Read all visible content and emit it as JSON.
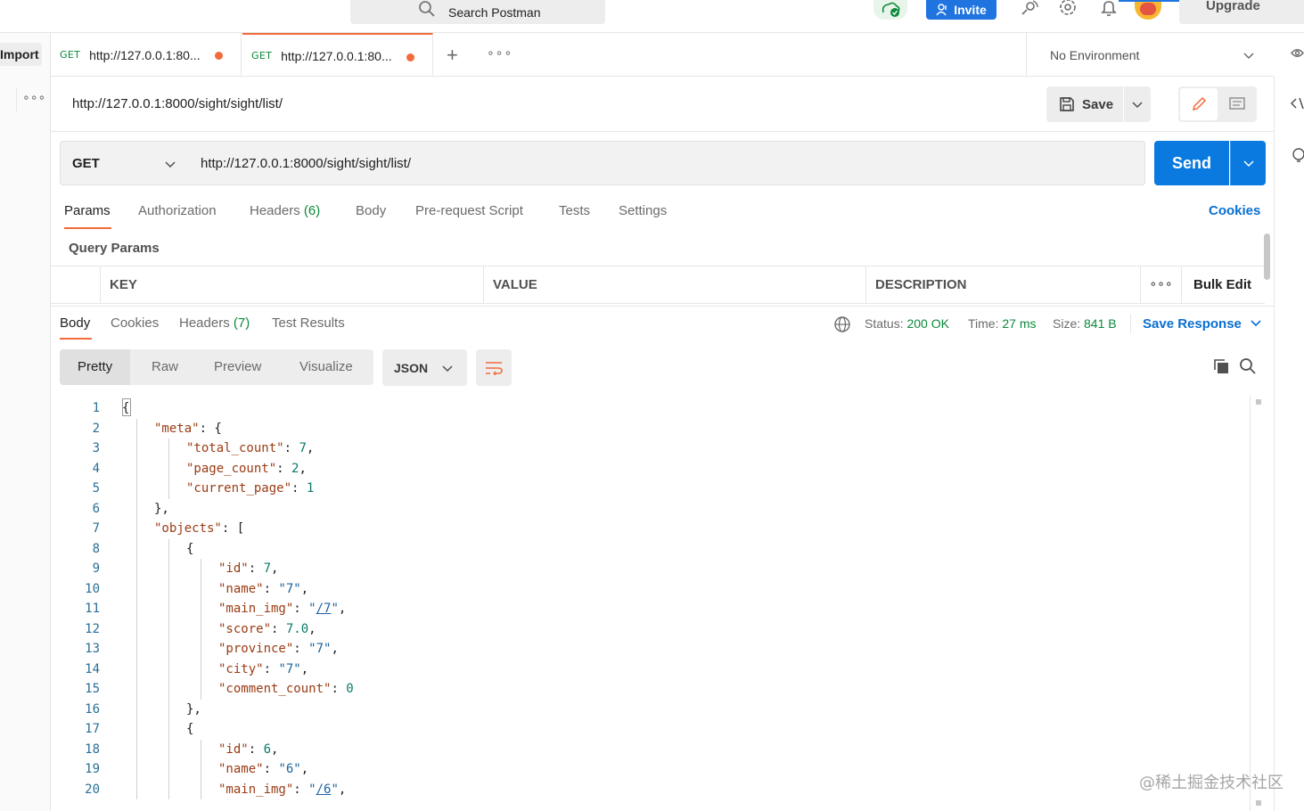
{
  "header": {
    "search_placeholder": "Search Postman",
    "invite_label": "Invite",
    "upgrade_label": "Upgrade"
  },
  "sidebar": {
    "import_label": "Import",
    "more_label": "∘∘∘"
  },
  "tabs": [
    {
      "method": "GET",
      "url": "http://127.0.0.1:80...",
      "unsaved": true,
      "active": false
    },
    {
      "method": "GET",
      "url": "http://127.0.0.1:80...",
      "unsaved": true,
      "active": true
    }
  ],
  "tabs_bar": {
    "add_label": "+",
    "more_label": "∘∘∘",
    "environment": "No Environment"
  },
  "request": {
    "title": "http://127.0.0.1:8000/sight/sight/list/",
    "save_label": "Save",
    "method": "GET",
    "url": "http://127.0.0.1:8000/sight/sight/list/",
    "send_label": "Send"
  },
  "request_tabs": {
    "items": [
      {
        "label": "Params",
        "count": ""
      },
      {
        "label": "Authorization",
        "count": ""
      },
      {
        "label": "Headers",
        "count": "(6)"
      },
      {
        "label": "Body",
        "count": ""
      },
      {
        "label": "Pre-request Script",
        "count": ""
      },
      {
        "label": "Tests",
        "count": ""
      },
      {
        "label": "Settings",
        "count": ""
      }
    ],
    "cookies_label": "Cookies"
  },
  "query_params": {
    "title": "Query Params",
    "columns": [
      "KEY",
      "VALUE",
      "DESCRIPTION"
    ],
    "more_label": "∘∘∘",
    "bulk_edit_label": "Bulk Edit"
  },
  "response": {
    "tabs": [
      {
        "label": "Body",
        "count": ""
      },
      {
        "label": "Cookies",
        "count": ""
      },
      {
        "label": "Headers",
        "count": "(7)"
      },
      {
        "label": "Test Results",
        "count": ""
      }
    ],
    "status_label": "Status:",
    "status_value": "200 OK",
    "time_label": "Time:",
    "time_value": "27 ms",
    "size_label": "Size:",
    "size_value": "841 B",
    "save_response_label": "Save Response",
    "views": [
      "Pretty",
      "Raw",
      "Preview",
      "Visualize"
    ],
    "format": "JSON"
  },
  "code_lines": [
    {
      "n": "1",
      "indent": 0,
      "parts": [
        [
          "p",
          "{"
        ]
      ]
    },
    {
      "n": "2",
      "indent": 1,
      "parts": [
        [
          "k",
          "\"meta\""
        ],
        [
          "p",
          ": {"
        ]
      ]
    },
    {
      "n": "3",
      "indent": 2,
      "parts": [
        [
          "k",
          "\"total_count\""
        ],
        [
          "p",
          ": "
        ],
        [
          "n",
          "7"
        ],
        [
          "p",
          ","
        ]
      ]
    },
    {
      "n": "4",
      "indent": 2,
      "parts": [
        [
          "k",
          "\"page_count\""
        ],
        [
          "p",
          ": "
        ],
        [
          "n",
          "2"
        ],
        [
          "p",
          ","
        ]
      ]
    },
    {
      "n": "5",
      "indent": 2,
      "parts": [
        [
          "k",
          "\"current_page\""
        ],
        [
          "p",
          ": "
        ],
        [
          "n",
          "1"
        ]
      ]
    },
    {
      "n": "6",
      "indent": 1,
      "parts": [
        [
          "p",
          "},"
        ]
      ]
    },
    {
      "n": "7",
      "indent": 1,
      "parts": [
        [
          "k",
          "\"objects\""
        ],
        [
          "p",
          ": ["
        ]
      ]
    },
    {
      "n": "8",
      "indent": 2,
      "parts": [
        [
          "p",
          "{"
        ]
      ]
    },
    {
      "n": "9",
      "indent": 3,
      "parts": [
        [
          "k",
          "\"id\""
        ],
        [
          "p",
          ": "
        ],
        [
          "n",
          "7"
        ],
        [
          "p",
          ","
        ]
      ]
    },
    {
      "n": "10",
      "indent": 3,
      "parts": [
        [
          "k",
          "\"name\""
        ],
        [
          "p",
          ": "
        ],
        [
          "s",
          "\"7\""
        ],
        [
          "p",
          ","
        ]
      ]
    },
    {
      "n": "11",
      "indent": 3,
      "parts": [
        [
          "k",
          "\"main_img\""
        ],
        [
          "p",
          ": "
        ],
        [
          "s",
          "\""
        ],
        [
          "l",
          "/7"
        ],
        [
          "s",
          "\""
        ],
        [
          "p",
          ","
        ]
      ]
    },
    {
      "n": "12",
      "indent": 3,
      "parts": [
        [
          "k",
          "\"score\""
        ],
        [
          "p",
          ": "
        ],
        [
          "n",
          "7.0"
        ],
        [
          "p",
          ","
        ]
      ]
    },
    {
      "n": "13",
      "indent": 3,
      "parts": [
        [
          "k",
          "\"province\""
        ],
        [
          "p",
          ": "
        ],
        [
          "s",
          "\"7\""
        ],
        [
          "p",
          ","
        ]
      ]
    },
    {
      "n": "14",
      "indent": 3,
      "parts": [
        [
          "k",
          "\"city\""
        ],
        [
          "p",
          ": "
        ],
        [
          "s",
          "\"7\""
        ],
        [
          "p",
          ","
        ]
      ]
    },
    {
      "n": "15",
      "indent": 3,
      "parts": [
        [
          "k",
          "\"comment_count\""
        ],
        [
          "p",
          ": "
        ],
        [
          "n",
          "0"
        ]
      ]
    },
    {
      "n": "16",
      "indent": 2,
      "parts": [
        [
          "p",
          "},"
        ]
      ]
    },
    {
      "n": "17",
      "indent": 2,
      "parts": [
        [
          "p",
          "{"
        ]
      ]
    },
    {
      "n": "18",
      "indent": 3,
      "parts": [
        [
          "k",
          "\"id\""
        ],
        [
          "p",
          ": "
        ],
        [
          "n",
          "6"
        ],
        [
          "p",
          ","
        ]
      ]
    },
    {
      "n": "19",
      "indent": 3,
      "parts": [
        [
          "k",
          "\"name\""
        ],
        [
          "p",
          ": "
        ],
        [
          "s",
          "\"6\""
        ],
        [
          "p",
          ","
        ]
      ]
    },
    {
      "n": "20",
      "indent": 3,
      "parts": [
        [
          "k",
          "\"main_img\""
        ],
        [
          "p",
          ": "
        ],
        [
          "s",
          "\""
        ],
        [
          "l",
          "/6"
        ],
        [
          "s",
          "\""
        ],
        [
          "p",
          ","
        ]
      ]
    }
  ],
  "watermark": "@稀土掘金技术社区",
  "colors": {
    "accent_orange": "#f26b3a",
    "send_blue": "#0a7ae0",
    "link_blue": "#0a6fd0",
    "success_green": "#0b8a3b"
  }
}
